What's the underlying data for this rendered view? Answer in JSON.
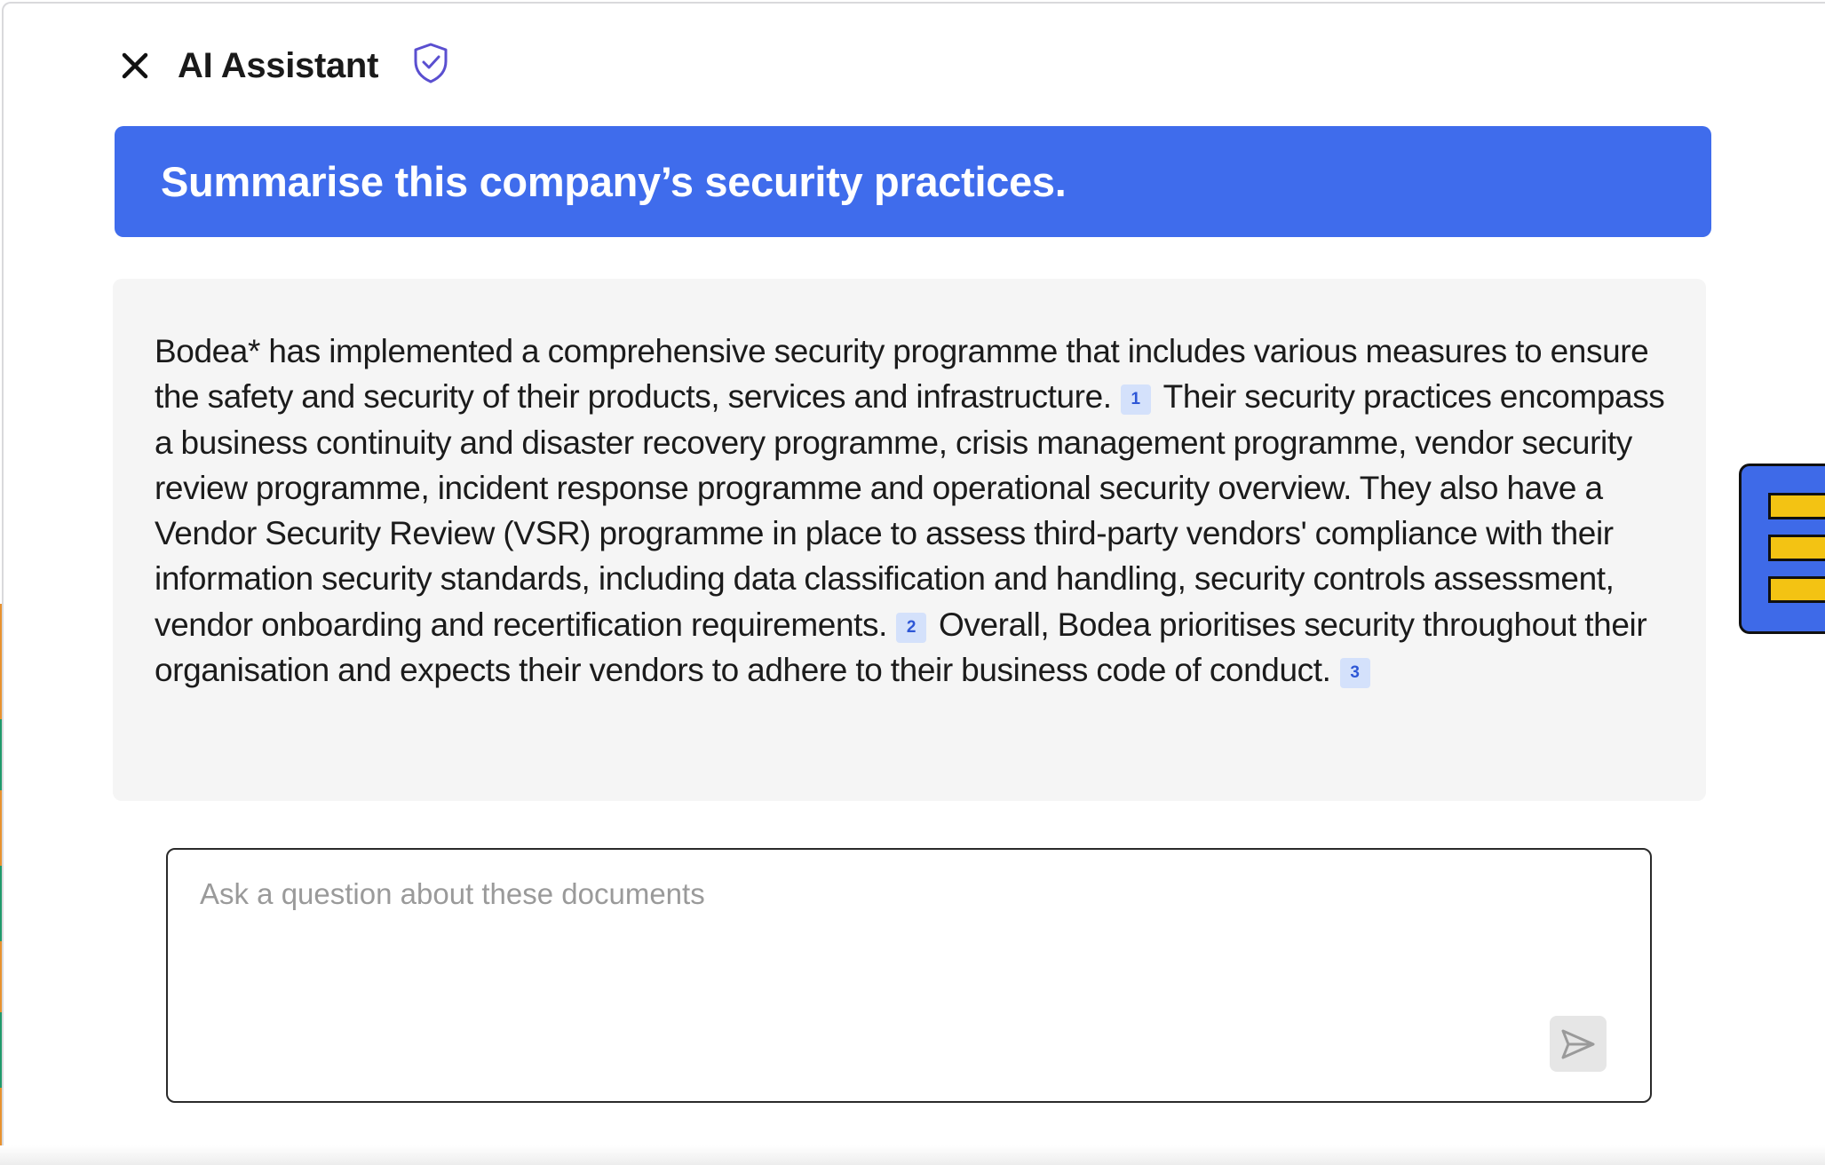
{
  "header": {
    "title": "AI Assistant",
    "close_icon": "close-icon",
    "shield_icon": "shield-check-icon"
  },
  "prompt": {
    "text": "Summarise this company’s security practices."
  },
  "answer": {
    "segments": [
      "Bodea* has implemented a comprehensive security programme that includes various measures to ensure the safety and security of their products, services and infrastructure.",
      "Their security practices encompass a business continuity and disaster recovery programme, crisis management programme, vendor security review programme, incident response programme and operational security overview. They also have a Vendor Security Review (VSR) programme in place to assess third-party vendors' compliance with their information security standards, including data classification and handling, security controls assessment, vendor onboarding and recertification requirements.",
      "Overall, Bodea prioritises security throughout their organisation and expects their vendors to adhere to their business code of conduct."
    ],
    "citations": [
      "1",
      "2",
      "3"
    ]
  },
  "composer": {
    "placeholder": "Ask a question about these documents",
    "value": "",
    "send_icon": "send-icon"
  },
  "colors": {
    "accent": "#3f6cec",
    "citation_bg": "#d4e1fb",
    "citation_text": "#2e57d6",
    "answer_bg": "#f5f5f5",
    "tab_yellow": "#f3c313"
  }
}
